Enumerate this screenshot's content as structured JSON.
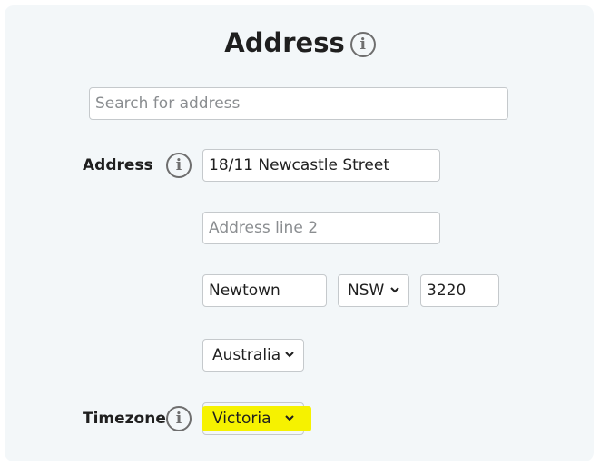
{
  "header": {
    "title": "Address"
  },
  "search": {
    "placeholder": "Search for address",
    "value": ""
  },
  "address": {
    "label": "Address",
    "line1_value": "18/11 Newcastle Street",
    "line2_placeholder": "Address line 2",
    "line2_value": "",
    "city_value": "Newtown",
    "state_selected": "NSW",
    "postcode_value": "3220",
    "country_selected": "Australia"
  },
  "timezone": {
    "label": "Timezone",
    "selected": "Victoria",
    "highlight_color": "#f6f200"
  },
  "icons": {
    "info": "info-icon",
    "dropdown": "chevron-down-icon"
  },
  "colors": {
    "panel_background": "#f3f7f9",
    "border": "#c5c9cc",
    "text": "#1f1f1f"
  }
}
